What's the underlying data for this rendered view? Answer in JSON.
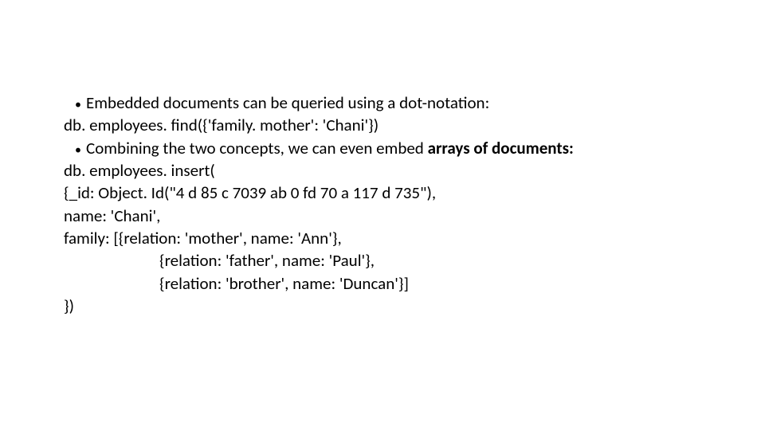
{
  "bullets": {
    "b1": "Embedded documents can be queried using a dot-notation:",
    "b2_pre": "Combining the two concepts, we can even embed ",
    "b2_bold": "arrays of documents:"
  },
  "code": {
    "l1": "db. employees. find({'family. mother': 'Chani'})",
    "l2": "db. employees. insert(",
    "l3": "{_id: Object. Id(\"4 d 85 c 7039 ab 0 fd 70 a 117 d 735\"),",
    "l4": "name: 'Chani',",
    "l5": "family: [{relation: 'mother', name: 'Ann'},",
    "l6": "{relation: 'father', name: 'Paul'},",
    "l7": "{relation: 'brother', name: 'Duncan'}]",
    "l8": "})"
  }
}
